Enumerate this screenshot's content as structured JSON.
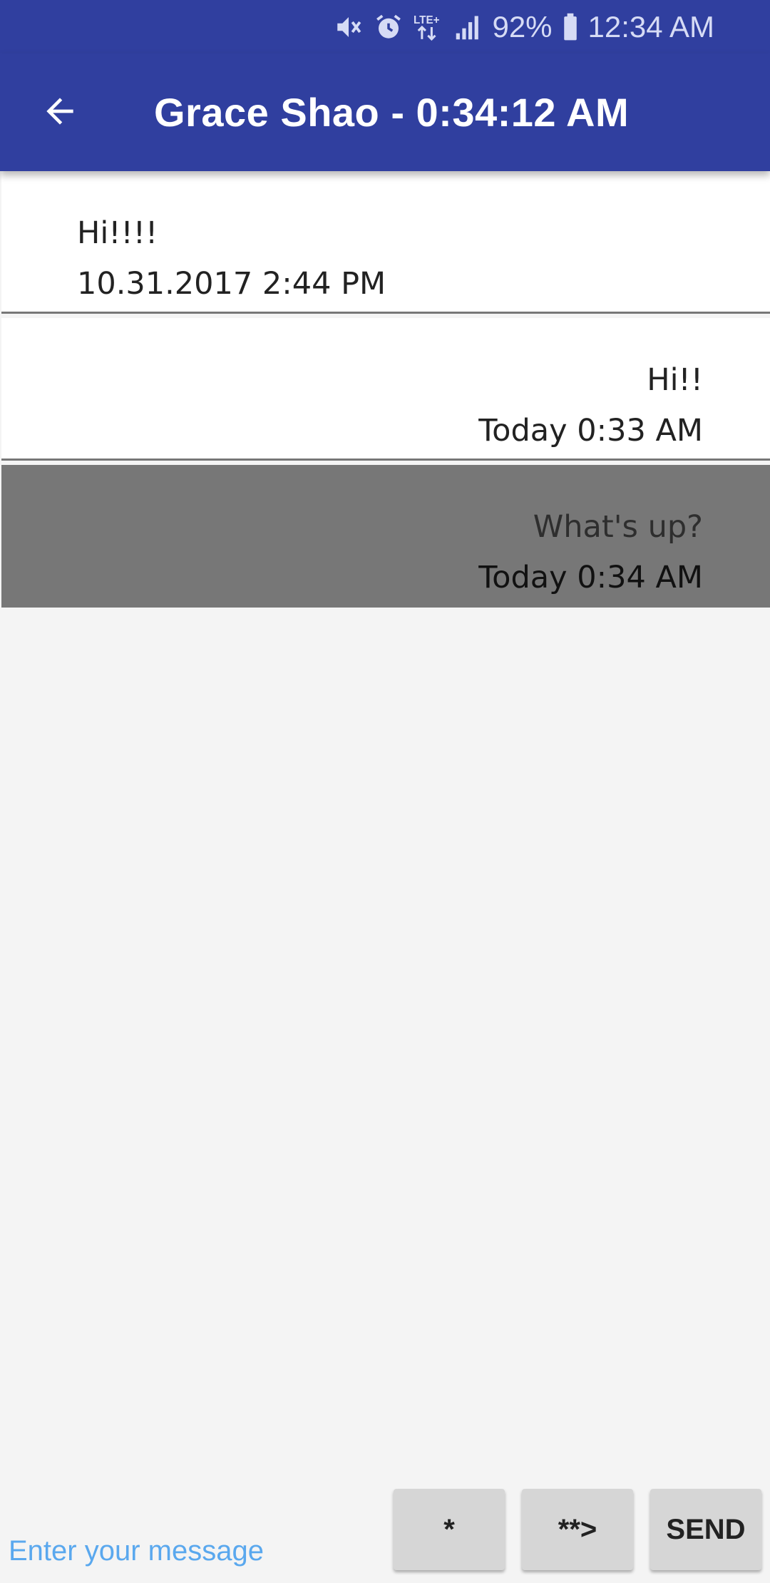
{
  "status_bar": {
    "battery": "92%",
    "time": "12:34 AM",
    "network": "LTE+",
    "icons": [
      "mute-icon",
      "alarm-icon",
      "lte-icon",
      "signal-icon",
      "battery-icon"
    ]
  },
  "app_bar": {
    "title": "Grace Shao - 0:34:12 AM",
    "back_icon": "arrow-back-icon",
    "color": "#303f9f"
  },
  "messages": [
    {
      "text": "Hi!!!!",
      "time": "10.31.2017 2:44 PM",
      "align": "left",
      "selected": false
    },
    {
      "text": "Hi!!",
      "time": "Today 0:33 AM",
      "align": "right",
      "selected": false
    },
    {
      "text": "What's up?",
      "time": "Today 0:34 AM",
      "align": "right",
      "selected": true
    }
  ],
  "composer": {
    "placeholder": "Enter your message",
    "buttons": [
      "*",
      "**>",
      "SEND"
    ]
  }
}
